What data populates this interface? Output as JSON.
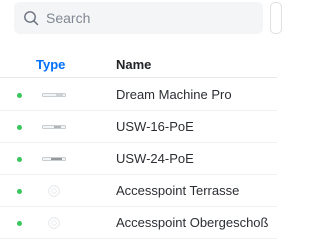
{
  "search": {
    "placeholder": "Search",
    "value": ""
  },
  "table": {
    "columns": {
      "type": "Type",
      "name": "Name"
    },
    "rows": [
      {
        "name": "Dream Machine Pro",
        "status": "online",
        "icon": "rack-device-icon"
      },
      {
        "name": "USW-16-PoE",
        "status": "online",
        "icon": "switch-device-icon"
      },
      {
        "name": "USW-24-PoE",
        "status": "online",
        "icon": "switch-device-icon"
      },
      {
        "name": "Accesspoint Terrasse",
        "status": "online",
        "icon": "access-point-icon"
      },
      {
        "name": "Accesspoint Obergeschoß",
        "status": "online",
        "icon": "access-point-icon"
      }
    ]
  },
  "colors": {
    "accent": "#006fff",
    "online": "#39c65c"
  }
}
